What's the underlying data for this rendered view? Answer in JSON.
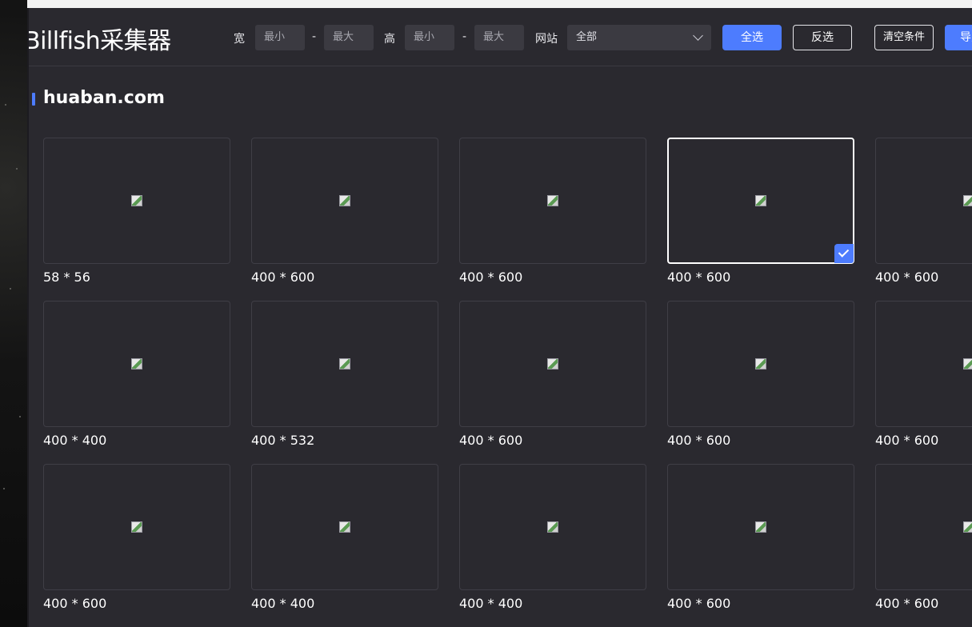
{
  "header": {
    "app_title": "Billfish采集器",
    "width_label": "宽",
    "height_label": "高",
    "site_label": "网站",
    "min_placeholder": "最小",
    "max_placeholder": "最大",
    "range_sep": "-",
    "site_select_value": "全部",
    "buttons": {
      "select_all": "全选",
      "invert": "反选",
      "clear": "清空条件",
      "import": "导入"
    }
  },
  "section": {
    "title": "huaban.com"
  },
  "images": [
    {
      "dims": "58 * 56",
      "selected": false
    },
    {
      "dims": "400 * 600",
      "selected": false
    },
    {
      "dims": "400 * 600",
      "selected": false
    },
    {
      "dims": "400 * 600",
      "selected": true
    },
    {
      "dims": "400 * 600",
      "selected": false
    },
    {
      "dims": "400 * 400",
      "selected": false
    },
    {
      "dims": "400 * 532",
      "selected": false
    },
    {
      "dims": "400 * 600",
      "selected": false
    },
    {
      "dims": "400 * 600",
      "selected": false
    },
    {
      "dims": "400 * 600",
      "selected": false
    },
    {
      "dims": "400 * 600",
      "selected": false
    },
    {
      "dims": "400 * 400",
      "selected": false
    },
    {
      "dims": "400 * 400",
      "selected": false
    },
    {
      "dims": "400 * 600",
      "selected": false
    },
    {
      "dims": "400 * 600",
      "selected": false
    }
  ],
  "colors": {
    "accent": "#4d7cfe",
    "panel_bg": "#2a292f",
    "input_bg": "#3b3a41"
  }
}
